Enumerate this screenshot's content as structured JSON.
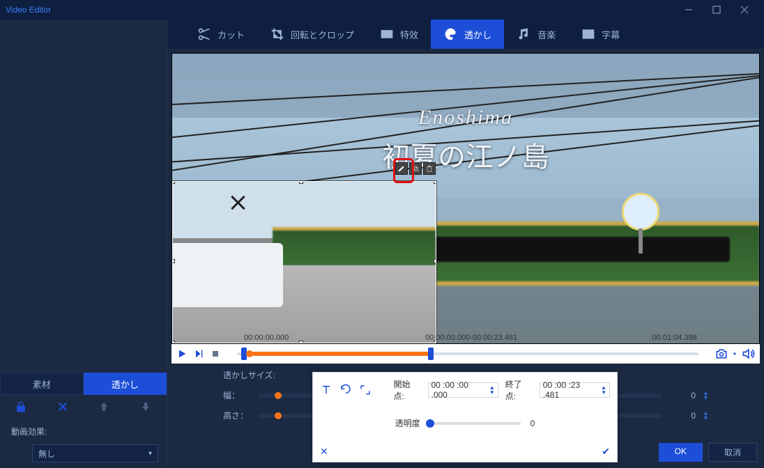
{
  "titlebar": {
    "title": "Video Editor"
  },
  "tabs": {
    "cut": "カット",
    "rotate_crop": "回転とクロップ",
    "effect": "特效",
    "watermark": "透かし",
    "music": "音楽",
    "subtitle": "字幕"
  },
  "left": {
    "material_tab": "素材",
    "watermark_tab": "透かし",
    "section_video_effect": "動画効果:",
    "dropdown_none": "無し"
  },
  "overlay": {
    "line1": "Enoshima",
    "line2": "初夏の江ノ島"
  },
  "player": {
    "tc_start": "00:00:00.000",
    "tc_range": "00:00:00.000-00:00:23.481",
    "tc_total": "00:01:04.398"
  },
  "props": {
    "size_title": "透かしサイズ:",
    "width_label": "幅：",
    "height_label": "高さ：",
    "width_val": "0",
    "height_val": "0"
  },
  "popup": {
    "start_label": "開始点:",
    "end_label": "終了点:",
    "start_val": "00 :00 :00 .000",
    "end_val": "00 :00 :23 .481",
    "opacity_label": "透明度",
    "opacity_val": "0"
  },
  "buttons": {
    "ok": "OK",
    "cancel": "取消"
  }
}
